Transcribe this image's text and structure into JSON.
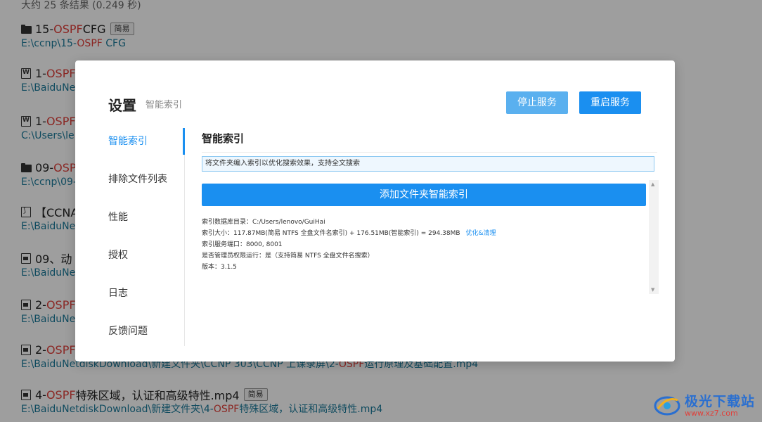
{
  "search": {
    "summary": "大约 25 条结果 (0.249 秒)",
    "results": [
      {
        "icon": "folder-icon",
        "title_pre": "15-",
        "title_hl": "OSPF",
        "title_post": " CFG",
        "tag": "简易",
        "path_pre": "E:\\ccnp\\15-",
        "path_hl": "OSPF",
        "path_post": " CFG"
      },
      {
        "icon": "word-doc-icon",
        "title_pre": "1-",
        "title_hl": "OSPF",
        "title_post": "",
        "tag": "",
        "path_pre": "E:\\BaiduNe",
        "path_hl": "",
        "path_post": ""
      },
      {
        "icon": "word-doc-icon",
        "title_pre": "1-",
        "title_hl": "OSPF",
        "title_post": "",
        "tag": "",
        "path_pre": "C:\\Users\\le",
        "path_hl": "",
        "path_post": ""
      },
      {
        "icon": "folder-icon",
        "title_pre": "09-",
        "title_hl": "OSPF",
        "title_post": "",
        "tag": "",
        "path_pre": "E:\\ccnp\\09-",
        "path_hl": "",
        "path_post": ""
      },
      {
        "icon": "pdf-icon",
        "title_pre": "【CCNA",
        "title_hl": "",
        "title_post": "",
        "tag": "",
        "path_pre": "E:\\BaiduNe",
        "path_hl": "",
        "path_post": ""
      },
      {
        "icon": "video-file-icon",
        "title_pre": "09、动",
        "title_hl": "",
        "title_post": "",
        "tag": "",
        "path_pre": "E:\\BaiduNe",
        "path_hl": "",
        "path_post": ""
      },
      {
        "icon": "video-file-icon",
        "title_pre": "2-",
        "title_hl": "OSPF",
        "title_post": "",
        "tag": "",
        "path_pre": "E:\\BaiduNe",
        "path_hl": "",
        "path_post": ""
      },
      {
        "icon": "video-file-icon",
        "title_pre": "2-",
        "title_hl": "OSPF",
        "title_post": "",
        "tag": "",
        "path_pre": "E:\\BaiduNetdiskDownload\\新建文件夹\\CCNP 303\\CCNP 上课录屏\\2-",
        "path_hl": "OSPF",
        "path_post": "运行原理及基础配置.mp4"
      },
      {
        "icon": "video-file-icon",
        "title_pre": "4-",
        "title_hl": "OSPF",
        "title_post": "特殊区域，认证和高级特性.mp4",
        "tag": "简易",
        "path_pre": "E:\\BaiduNetdiskDownload\\新建文件夹\\4-",
        "path_hl": "OSPF",
        "path_post": "特殊区域，认证和高级特性.mp4"
      }
    ]
  },
  "modal": {
    "title": "设置",
    "subtitle": "智能索引",
    "stop_button": "停止服务",
    "restart_button": "重启服务",
    "nav": [
      "智能索引",
      "排除文件列表",
      "性能",
      "授权",
      "日志",
      "反馈问题"
    ],
    "active_nav": 0,
    "section_title": "智能索引",
    "info_text": "将文件夹编入索引以优化搜索效果，支持全文搜索",
    "add_button": "添加文件夹智能索引",
    "info": {
      "db_dir": "索引数据库目录：C:/Users/lenovo/GuiHai",
      "size": "索引大小：117.87MB(简易 NTFS 全盘文件名索引) + 176.51MB(智能索引) = 294.38MB",
      "optimize_link": "优化&清理",
      "port": "索引服务端口：8000, 8001",
      "admin": "是否管理员权限运行：是（支持简易 NTFS 全盘文件名搜索）",
      "version": "版本：3.1.5"
    }
  },
  "watermark": {
    "name": "极光下载站",
    "url": "www.xz7.com"
  }
}
